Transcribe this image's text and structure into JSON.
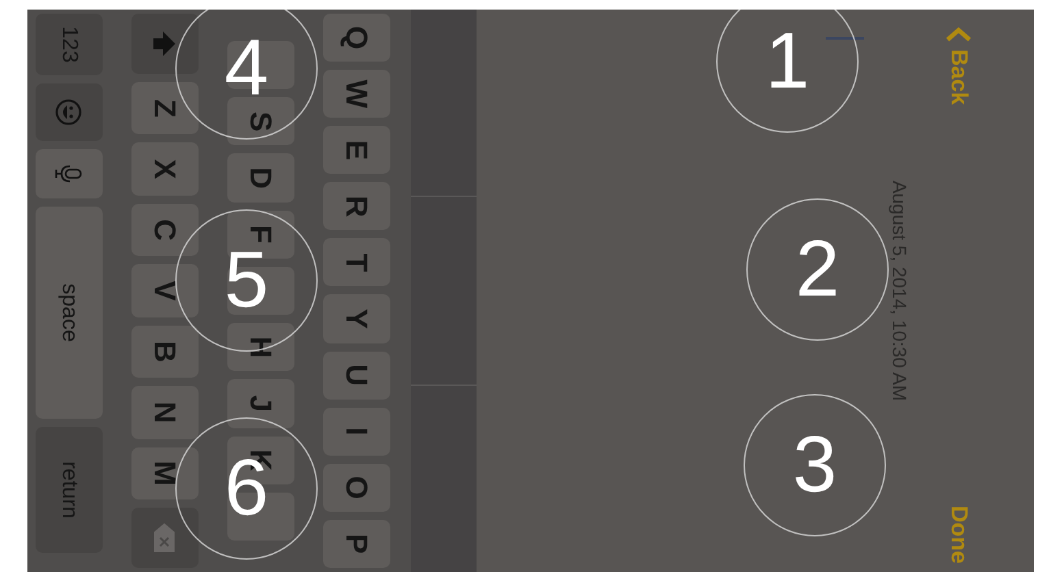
{
  "nav": {
    "back": "Back",
    "done": "Done"
  },
  "date": "August 5, 2014, 10:30 AM",
  "keyboard": {
    "top_row": [
      "Q",
      "W",
      "E",
      "R",
      "T",
      "Y",
      "U",
      "I",
      "O",
      "P"
    ],
    "middle_row": [
      {
        "kind": "covered"
      },
      {
        "kind": "letter",
        "label": "S"
      },
      {
        "kind": "letter",
        "label": "D"
      },
      {
        "kind": "letter",
        "label": "F"
      },
      {
        "kind": "covered"
      },
      {
        "kind": "letter",
        "label": "H"
      },
      {
        "kind": "letter",
        "label": "J"
      },
      {
        "kind": "letter",
        "label": "K"
      },
      {
        "kind": "covered"
      }
    ],
    "bottom_row": [
      "Z",
      "X",
      "C",
      "V",
      "B",
      "N",
      "M"
    ],
    "numbers_key": "123",
    "space_key": "space",
    "return_key": "return"
  },
  "callouts": [
    {
      "label": "4"
    },
    {
      "label": "5"
    },
    {
      "label": "6"
    },
    {
      "label": "1"
    },
    {
      "label": "2"
    },
    {
      "label": "3"
    }
  ]
}
